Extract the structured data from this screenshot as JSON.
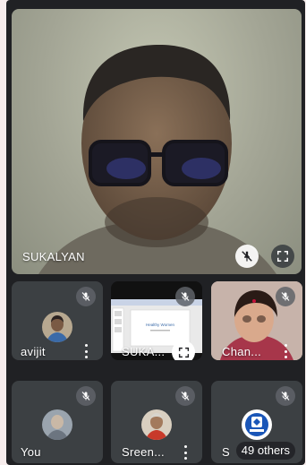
{
  "main_speaker": {
    "name": "SUKALYAN"
  },
  "tiles": [
    {
      "name": "avijit"
    },
    {
      "name": "SUKA..."
    },
    {
      "name": "Chan..."
    },
    {
      "name": "You"
    },
    {
      "name": "Sreen..."
    },
    {
      "name": "S"
    }
  ],
  "presentation": {
    "slide_title": "Healthy Women"
  },
  "others": {
    "label": "49 others"
  },
  "colors": {
    "tile_bg": "#3c4043",
    "frame_bg": "#202124",
    "accent_blue": "#1a56b8"
  },
  "icons": {
    "mic_off": "mic-off-icon",
    "pin_off": "pin-off-icon",
    "fullscreen": "fullscreen-icon",
    "more": "more-vert-icon"
  }
}
